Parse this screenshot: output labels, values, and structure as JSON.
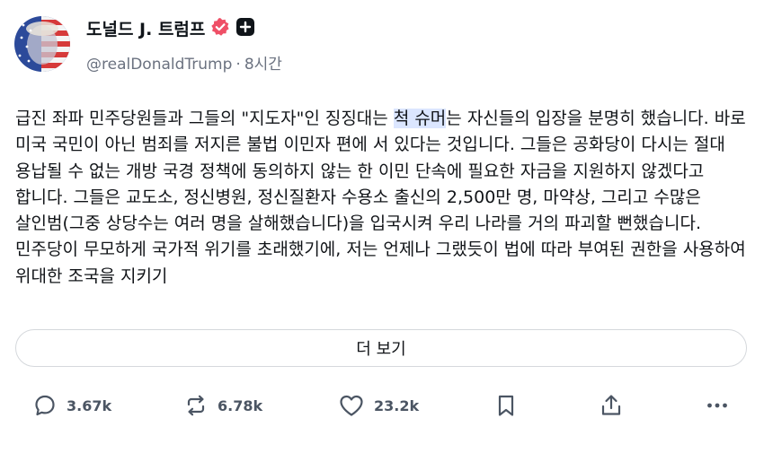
{
  "author": {
    "display_name": "도널드 J. 트럼프",
    "handle": "@realDonaldTrump",
    "dot": "·",
    "time_ago": "8시간"
  },
  "post": {
    "line1_a": "급진 좌파 민주당원들과 그들의 \"지도자\"인 징징대는 ",
    "line1_highlight": "척 슈머",
    "line1_b": "는 자신들의 입장을 분명히 했습니다. 바로 미국 국민이 아닌 범죄를 저지른 불법 이민자 편에 서 있다는 것입니다. 그들은 공화당이 다시는 절대 용납될 수 없는 개방 국경 정책에 동의하지 않는 한 이민 단속에 필요한 자금을 지원하지 않겠다고 합니다. 그들은 교도소, 정신병원, 정신질환자 수용소 출신의 2,500만 명, 마약상, 그리고 수많은 살인범(그중 상당수는 여러 명을 살해했습니다)을 입국시켜 우리 나라를 거의 파괴할 뻔했습니다. 민주당이 무모하게 국가적 위기를 초래했기에, 저는 언제나 그랬듯이 법에 따라 부여된 권한을 사용하여 위대한 조국을 지키기"
  },
  "show_more_label": "더 보기",
  "actions": {
    "replies": "3.67k",
    "reposts": "6.78k",
    "likes": "23.2k"
  },
  "colors": {
    "verified_badge": "#ef4f66",
    "highlight": "#dbe6ff",
    "text": "#111418",
    "muted": "#6b7280"
  },
  "icons": [
    "verified-badge-icon",
    "plus-badge-icon",
    "reply-icon",
    "repost-icon",
    "like-icon",
    "bookmark-icon",
    "share-icon",
    "more-icon"
  ]
}
